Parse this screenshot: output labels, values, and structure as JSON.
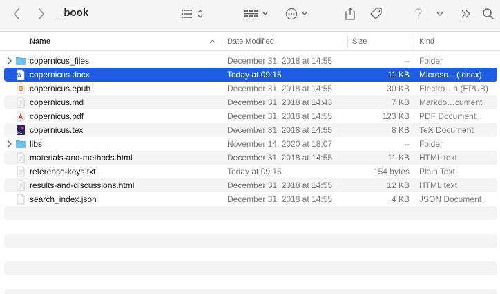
{
  "window": {
    "title": "_book"
  },
  "toolbar": {
    "back_icon": "chevron-left-icon",
    "forward_icon": "chevron-right-icon",
    "view_icon": "list-view-icon",
    "group_icon": "group-grid-icon",
    "action_icon": "ellipsis-circle-icon",
    "share_icon": "share-icon",
    "tag_icon": "tag-icon",
    "help_icon": "question-icon",
    "more_icon": "double-chevron-right-icon",
    "search_icon": "magnifier-icon"
  },
  "columns": {
    "name": "Name",
    "date": "Date Modified",
    "size": "Size",
    "kind": "Kind"
  },
  "colors": {
    "selection": "#1f5ee4",
    "folder": "#54b4f0",
    "stripe": "#f4f4f5"
  },
  "files": [
    {
      "name": "copernicus_files",
      "date": "December 31, 2018 at 14:55",
      "size": "--",
      "kind": "Folder",
      "icon": "folder",
      "expandable": true,
      "selected": false
    },
    {
      "name": "copernicus.docx",
      "date": "Today at 09:15",
      "size": "11 KB",
      "kind": "Microso…(.docx)",
      "icon": "word",
      "expandable": false,
      "selected": true
    },
    {
      "name": "copernicus.epub",
      "date": "December 31, 2018 at 14:55",
      "size": "30 KB",
      "kind": "Electro…n (EPUB)",
      "icon": "epub",
      "expandable": false,
      "selected": false
    },
    {
      "name": "copernicus.md",
      "date": "December 31, 2018 at 14:43",
      "size": "7 KB",
      "kind": "Markdo…cument",
      "icon": "doc",
      "expandable": false,
      "selected": false
    },
    {
      "name": "copernicus.pdf",
      "date": "December 31, 2018 at 14:55",
      "size": "123 KB",
      "kind": "PDF Document",
      "icon": "pdf",
      "expandable": false,
      "selected": false
    },
    {
      "name": "copernicus.tex",
      "date": "December 31, 2018 at 14:55",
      "size": "8 KB",
      "kind": "TeX Document",
      "icon": "tex",
      "expandable": false,
      "selected": false
    },
    {
      "name": "libs",
      "date": "November 14, 2020 at 18:07",
      "size": "--",
      "kind": "Folder",
      "icon": "folder",
      "expandable": true,
      "selected": false
    },
    {
      "name": "materials-and-methods.html",
      "date": "December 31, 2018 at 14:55",
      "size": "11 KB",
      "kind": "HTML text",
      "icon": "doc",
      "expandable": false,
      "selected": false
    },
    {
      "name": "reference-keys.txt",
      "date": "Today at 09:15",
      "size": "154 bytes",
      "kind": "Plain Text",
      "icon": "doc",
      "expandable": false,
      "selected": false
    },
    {
      "name": "results-and-discussions.html",
      "date": "December 31, 2018 at 14:55",
      "size": "12 KB",
      "kind": "HTML text",
      "icon": "doc",
      "expandable": false,
      "selected": false
    },
    {
      "name": "search_index.json",
      "date": "December 31, 2018 at 14:55",
      "size": "4 KB",
      "kind": "JSON Document",
      "icon": "blank",
      "expandable": false,
      "selected": false
    }
  ]
}
